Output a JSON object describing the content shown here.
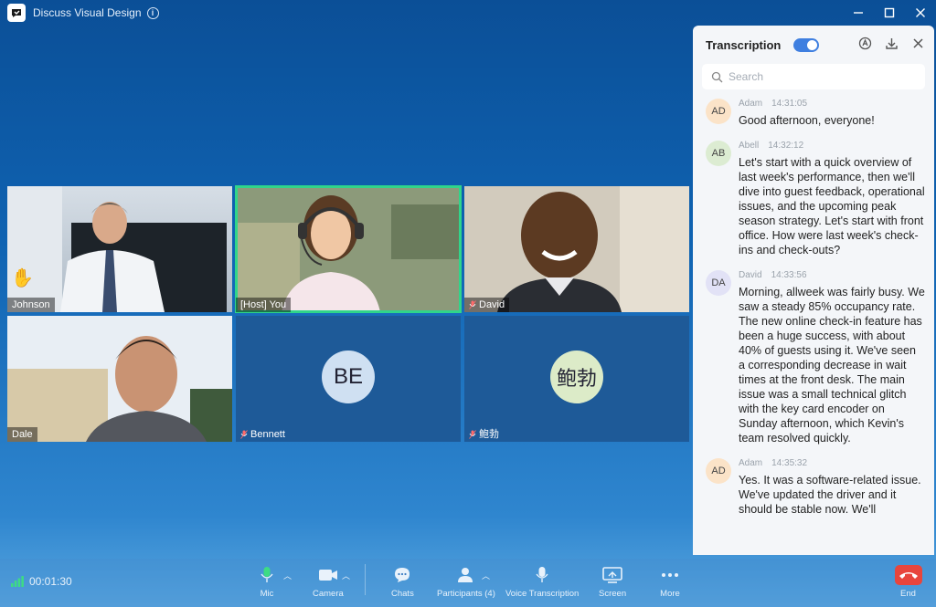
{
  "window": {
    "title": "Discuss Visual Design"
  },
  "participants": [
    {
      "name": "Johnson",
      "hand_raised": true,
      "type": "video",
      "bg": "#b9c6d2"
    },
    {
      "name": "[Host] You",
      "host": true,
      "type": "video",
      "bg": "#8d9a7e"
    },
    {
      "name": "David",
      "muted": true,
      "type": "video",
      "bg": "#6b5a4c"
    },
    {
      "name": "Dale",
      "type": "video",
      "bg": "#c9bfae"
    },
    {
      "name": "Bennett",
      "initials": "BE",
      "muted": true,
      "type": "avatar",
      "avatar_color": "#cfe0f2"
    },
    {
      "name": "鲍勃",
      "initials": "鲍勃",
      "muted": true,
      "type": "avatar",
      "avatar_color": "#dcebc8"
    }
  ],
  "toolbar": {
    "timer": "00:01:30",
    "mic_label": "Mic",
    "camera_label": "Camera",
    "chats_label": "Chats",
    "participants_label": "Participants (4)",
    "voice_label": "Voice Transcription",
    "screen_label": "Screen",
    "more_label": "More",
    "end_label": "End"
  },
  "transcription": {
    "title": "Transcription",
    "enabled": true,
    "search_placeholder": "Search",
    "messages": [
      {
        "initials": "AD",
        "name": "Adam",
        "time": "14:31:05",
        "text": "Good afternoon, everyone!",
        "color": "#fbe3c8"
      },
      {
        "initials": "AB",
        "name": "Abell",
        "time": "14:32:12",
        "text": "Let's start with a quick overview of last week's performance, then we'll dive into guest feedback, operational issues, and the upcoming peak season strategy. Let's start with front office. How were last week's check-ins and check-outs?",
        "color": "#dcecd2"
      },
      {
        "initials": "DA",
        "name": "David",
        "time": "14:33:56",
        "text": "Morning, allweek was fairly busy. We saw a steady 85% occupancy rate. The new online check-in feature has been a huge success, with about 40% of guests using it. We've seen a corresponding decrease in wait times at the front desk. The main issue was a small technical glitch with the key card encoder on Sunday afternoon, which Kevin's team resolved quickly.",
        "color": "#e2e2f6"
      },
      {
        "initials": "AD",
        "name": "Adam",
        "time": "14:35:32",
        "text": "Yes. It was a software-related issue. We've updated the driver and it should be stable now. We'll",
        "color": "#fbe3c8"
      }
    ]
  }
}
